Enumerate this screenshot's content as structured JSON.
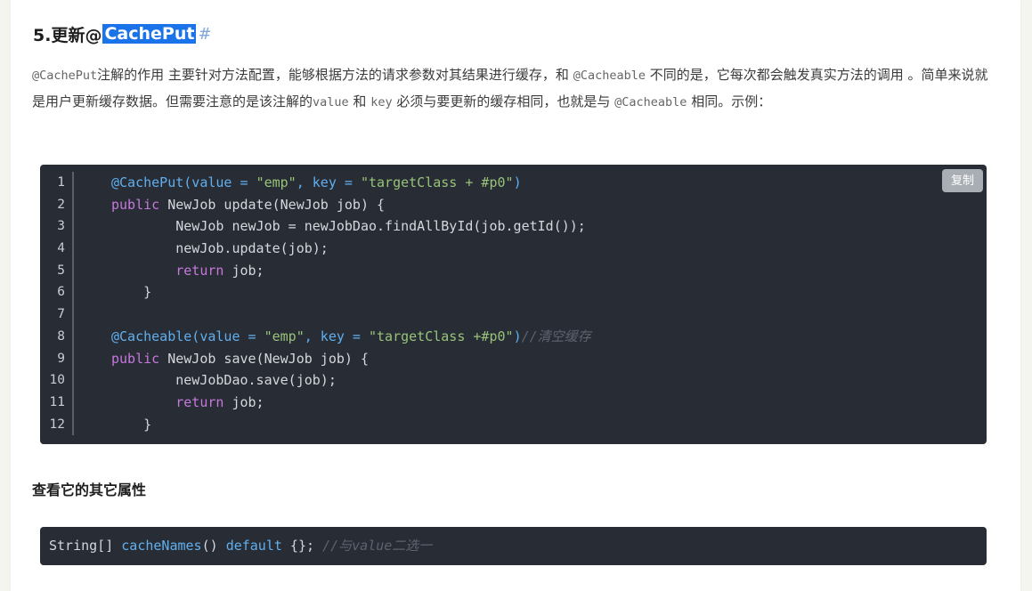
{
  "heading": {
    "prefix": "5.更新@",
    "highlight": "CachePut",
    "anchor": "#"
  },
  "paragraph": {
    "p1": "@CachePut",
    "p2": "注解的作用 主要针对方法配置，能够根据方法的请求参数对其结果进行缓存，和 ",
    "p3": "@Cacheable",
    "p4": " 不同的是，它每次都会触发真实方法的调用 。简单来说就是用户更新缓存数据。但需要注意的是该注解的",
    "p5": "value",
    "p6": " 和 ",
    "p7": "key",
    "p8": " 必须与要更新的缓存相同，也就是与 ",
    "p9": "@Cacheable",
    "p10": " 相同。示例："
  },
  "code1": {
    "copy_label": "复制",
    "line_numbers": [
      "1",
      "2",
      "3",
      "4",
      "5",
      "6",
      "7",
      "8",
      "9",
      "10",
      "11",
      "12"
    ],
    "l1": {
      "a": "@CachePut(value = ",
      "b": "\"emp\"",
      "c": ", key = ",
      "d": "\"targetClass + #p0\"",
      "e": ")"
    },
    "l2": {
      "kw": "public",
      "rest": " NewJob update(NewJob job) {"
    },
    "l3": "        NewJob newJob = newJobDao.findAllById(job.getId());",
    "l4": "        newJob.update(job);",
    "l5": {
      "indent": "        ",
      "kw": "return",
      "rest": " job;"
    },
    "l6": "    }",
    "l7": "",
    "l8": {
      "a": "@Cacheable(value = ",
      "b": "\"emp\"",
      "c": ", key = ",
      "d": "\"targetClass +#p0\"",
      "e": ")",
      "cm": "//清空缓存"
    },
    "l9": {
      "kw": "public",
      "rest": " NewJob save(NewJob job) {"
    },
    "l10": "        newJobDao.save(job);",
    "l11": {
      "indent": "        ",
      "kw": "return",
      "rest": " job;"
    },
    "l12": "    }"
  },
  "subheading": "查看它的其它属性",
  "code2": {
    "type": "String[] ",
    "fn": "cacheNames",
    "paren": "() ",
    "kw": "default",
    "rest": " {}; ",
    "cm": "//与value二选一"
  },
  "colors": {
    "highlight_bg": "#1a73e8",
    "code_bg": "#282c34",
    "annotation": "#61afef",
    "keyword": "#c678dd",
    "string": "#98c379",
    "comment": "#5c6370"
  }
}
